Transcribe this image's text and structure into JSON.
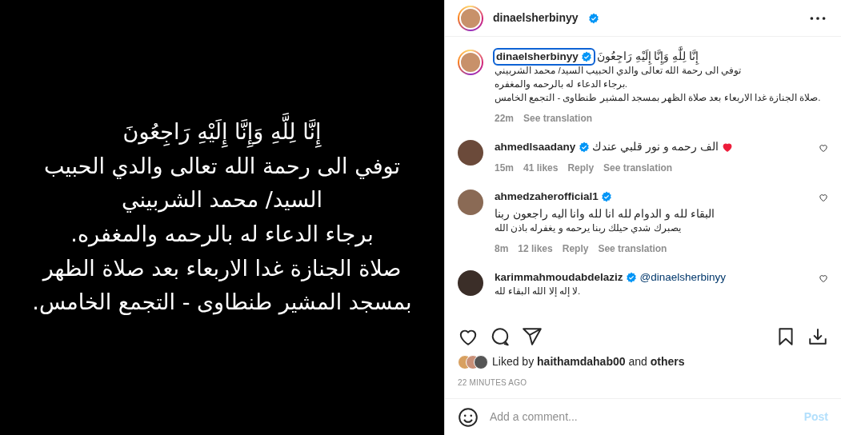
{
  "post_image": {
    "lines": [
      "إِنَّا لِلَّهِ وَإِنَّا إِلَيْهِ رَاجِعُونَ",
      "توفي الى رحمة الله تعالى والدي الحبيب",
      "السيد/ محمد الشربيني",
      "برجاء الدعاء له بالرحمه والمغفره.",
      "صلاة الجنازة غدا الاربعاء بعد صلاة الظهر",
      "بمسجد المشير طنطاوى - التجمع الخامس."
    ]
  },
  "header": {
    "username": "dinaelsherbinyy",
    "verified": true,
    "story_ring": true
  },
  "caption": {
    "username": "dinaelsherbinyy",
    "verified": true,
    "focused": true,
    "first_line": "إِنَّا لِلَّٰهِ وَإِنَّا إِلَيْهِ رَاجِعُونَ",
    "lines": [
      "توفي الى رحمة الله تعالى والدي الحبيب السيد/ محمد الشربيني",
      "برجاء الدعاء له بالرحمه والمغفره.",
      "صلاة الجنازة غدا الاربعاء بعد صلاة الظهر بمسجد المشير طنطاوى - التجمع الخامس."
    ],
    "time": "22m",
    "translate": "See translation"
  },
  "comments": [
    {
      "username": "ahmedlsaadany",
      "verified": true,
      "kind": "heart",
      "lines": [
        "الف رحمه و نور قلبي عندك"
      ],
      "time": "15m",
      "likes": "41 likes",
      "reply": "Reply",
      "translate": "See translation",
      "liked": false
    },
    {
      "username": "ahmedzaherofficial1",
      "verified": true,
      "kind": "text",
      "lines": [
        "البقاء لله و الدوام لله انا لله وانا اليه راجعون ربنا",
        "يصبرك شدي حيلك ربنا يرحمه و يغفرله باذن الله"
      ],
      "time": "8m",
      "likes": "12 likes",
      "reply": "Reply",
      "translate": "See translation",
      "liked": false
    },
    {
      "username": "karimmahmoudabdelaziz",
      "verified": true,
      "kind": "mention",
      "mention": "@dinaelsherbinyy",
      "lines": [
        "لا إله إلا الله البقاء لله."
      ],
      "liked": false
    }
  ],
  "actions": {
    "liked": false,
    "saved": false
  },
  "likes": {
    "prefix": "Liked by",
    "user": "haithamdahab00",
    "joiner": "and",
    "others": "others"
  },
  "timestamp": "22 MINUTES AGO",
  "composer": {
    "placeholder": "Add a comment...",
    "post": "Post",
    "disabled": true
  }
}
